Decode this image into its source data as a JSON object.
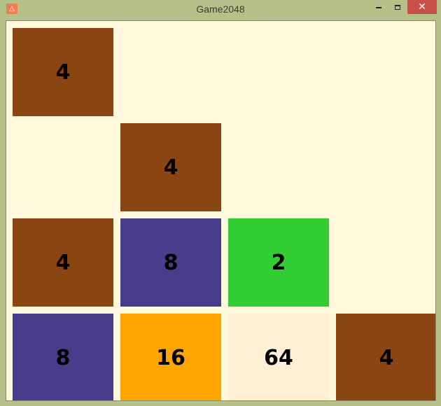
{
  "window": {
    "title": "Game2048",
    "icon": "app-icon",
    "controls": {
      "minimize": "minimize-icon",
      "maximize": "maximize-icon",
      "close": "close-icon"
    },
    "close_color": "#c7504b"
  },
  "board": {
    "background": "#fff8dc",
    "rows": [
      [
        {
          "value": "4",
          "color": "#8b4513"
        },
        null,
        null,
        null
      ],
      [
        null,
        {
          "value": "4",
          "color": "#8b4513"
        },
        null,
        null
      ],
      [
        {
          "value": "4",
          "color": "#8b4513"
        },
        {
          "value": "8",
          "color": "#483d8b"
        },
        {
          "value": "2",
          "color": "#32cd32"
        },
        null
      ],
      [
        {
          "value": "8",
          "color": "#483d8b"
        },
        {
          "value": "16",
          "color": "#ffa500"
        },
        {
          "value": "64",
          "color": "#ffefd5"
        },
        {
          "value": "4",
          "color": "#8b4513"
        }
      ]
    ]
  }
}
